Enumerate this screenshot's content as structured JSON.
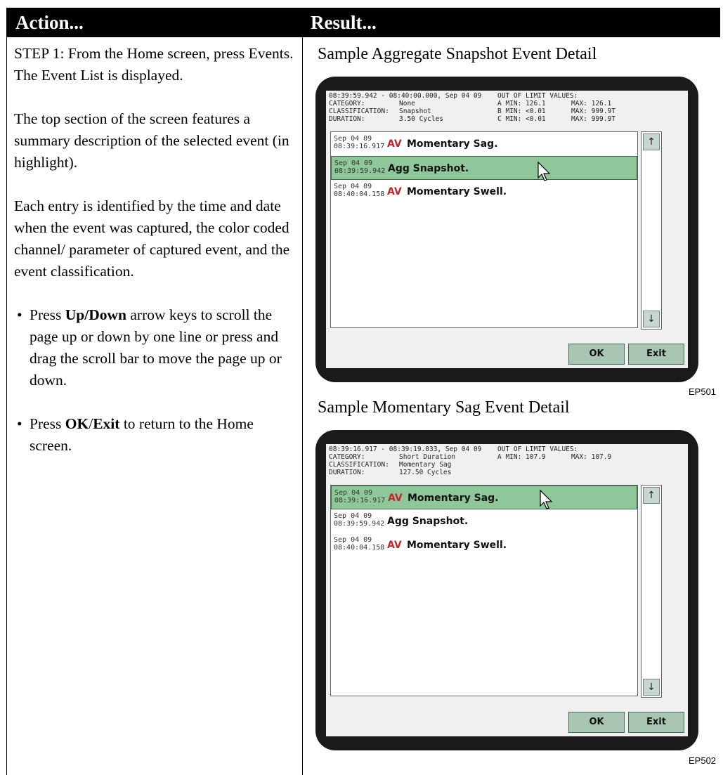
{
  "header": {
    "action": "Action...",
    "result": "Result..."
  },
  "action": {
    "p1": "STEP 1: From the Home screen, press Events. The Event List is displayed.",
    "p2": "The top section of the screen features a summary description of the selected event (in highlight).",
    "p3": "Each entry is identified by the time and date when the event was captured, the color coded channel/ parameter of captured event, and the event classification.",
    "b1": {
      "pre": "Press ",
      "bold": "Up/Down",
      "post": " arrow keys to scroll the page up or down by one line or press and drag the scroll bar to move the page up or down."
    },
    "b2": {
      "pre": "Press ",
      "bold1": "OK",
      "slash": "/",
      "bold2": "Exit",
      "post": " to return to the Home screen."
    },
    "bullet": "•"
  },
  "result": {
    "caption1": "Sample Aggregate Snapshot Event Detail",
    "caption2": "Sample Momentary Sag Event Detail",
    "fig1": "EP501",
    "fig2": "EP502"
  },
  "screen1": {
    "summary": {
      "line1": "08:39:59.942 - 08:40:00.000, Sep 04 09",
      "cat_label": "CATEGORY:",
      "cat_val": "None",
      "cls_label": "CLASSIFICATION:",
      "cls_val": "Snapshot",
      "dur_label": "DURATION:",
      "dur_val": "3.50 Cycles",
      "oolv": "OUT OF LIMIT VALUES:",
      "a_min": "A MIN: 126.1",
      "a_max": "MAX: 126.1",
      "b_min": "B MIN: <0.01",
      "b_max": "MAX: 999.9T",
      "c_min": "C MIN: <0.01",
      "c_max": "MAX: 999.9T"
    },
    "rows": [
      {
        "date": "Sep 04 09",
        "time": "08:39:16.917",
        "tag": "AV",
        "label": "Momentary Sag."
      },
      {
        "date": "Sep 04 09",
        "time": "08:39:59.942",
        "tag": "",
        "label": "Agg Snapshot."
      },
      {
        "date": "Sep 04 09",
        "time": "08:40:04.158",
        "tag": "AV",
        "label": "Momentary Swell."
      }
    ],
    "ok": "OK",
    "exit": "Exit"
  },
  "screen2": {
    "summary": {
      "line1": "08:39:16.917 - 08:39:19.033, Sep 04 09",
      "cat_label": "CATEGORY:",
      "cat_val": "Short Duration",
      "cls_label": "CLASSIFICATION:",
      "cls_val": "Momentary Sag",
      "dur_label": "DURATION:",
      "dur_val": "127.50 Cycles",
      "oolv": "OUT OF LIMIT VALUES:",
      "a_min": "A MIN: 107.9",
      "a_max": "MAX: 107.9"
    },
    "rows": [
      {
        "date": "Sep 04 09",
        "time": "08:39:16.917",
        "tag": "AV",
        "label": "Momentary Sag."
      },
      {
        "date": "Sep 04 09",
        "time": "08:39:59.942",
        "tag": "",
        "label": "Agg Snapshot."
      },
      {
        "date": "Sep 04 09",
        "time": "08:40:04.158",
        "tag": "AV",
        "label": "Momentary Swell."
      }
    ],
    "ok": "OK",
    "exit": "Exit"
  },
  "icons": {
    "up": "↑",
    "down": "↓",
    "cursor": "arrow-cursor-icon"
  }
}
